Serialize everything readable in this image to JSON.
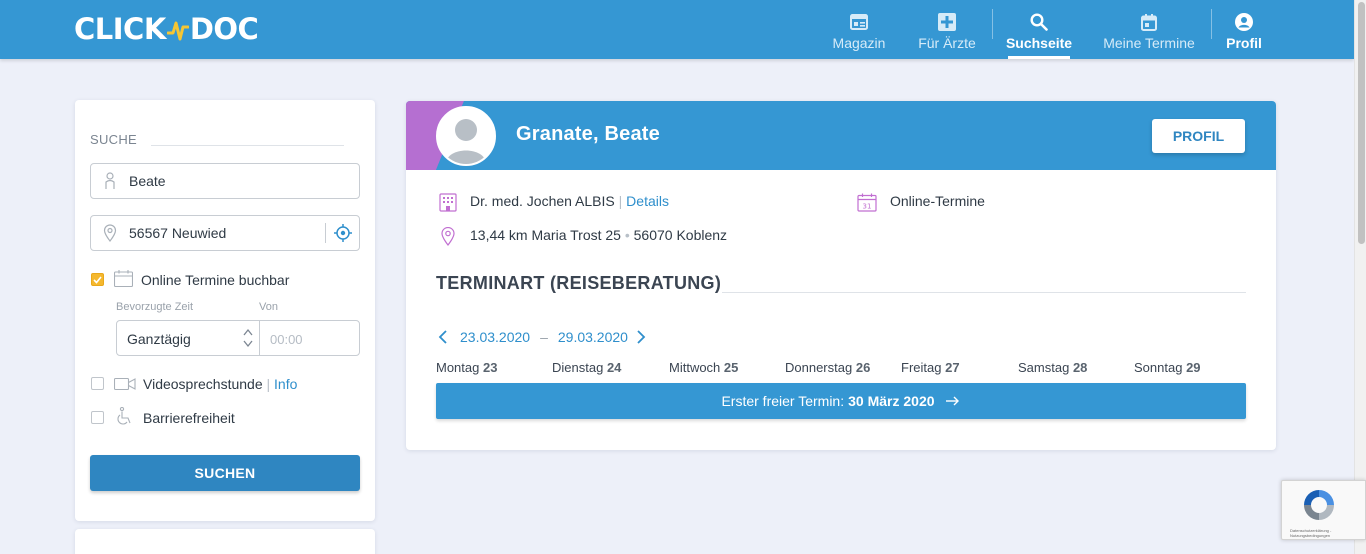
{
  "header": {
    "logo_left": "CLICK",
    "logo_right": "DOC",
    "nav": [
      {
        "label": "Magazin",
        "icon": "magazine-icon"
      },
      {
        "label": "Für Ärzte",
        "icon": "medical-cross-icon"
      },
      {
        "label": "Suchseite",
        "icon": "search-icon",
        "active": true
      },
      {
        "label": "Meine Termine",
        "icon": "calendar-icon"
      },
      {
        "label": "Profil",
        "icon": "user-circle-icon"
      }
    ]
  },
  "search": {
    "title": "SUCHE",
    "name_value": "Beate",
    "location_value": "56567 Neuwied",
    "online_label": "Online Termine buchbar",
    "online_checked": true,
    "pref_time_label": "Bevorzugte Zeit",
    "from_label": "Von",
    "time_select_value": "Ganztägig",
    "from_placeholder": "00:00",
    "video_label": "Videosprechstunde",
    "video_info": "Info",
    "barrier_label": "Barrierefreiheit",
    "submit_label": "SUCHEN"
  },
  "result": {
    "name": "Granate, Beate",
    "profile_button": "PROFIL",
    "practice": "Dr. med. Jochen ALBIS",
    "details_link": "Details",
    "online_appointments": "Online-Termine",
    "address": "13,44 km Maria Trost 25",
    "address_city": "56070 Koblenz",
    "terminart_title": "TERMINART (REISEBERATUNG)",
    "date_from": "23.03.2020",
    "date_to": "29.03.2020",
    "days": [
      {
        "name": "Montag",
        "num": "23"
      },
      {
        "name": "Dienstag",
        "num": "24"
      },
      {
        "name": "Mittwoch",
        "num": "25"
      },
      {
        "name": "Donnerstag",
        "num": "26"
      },
      {
        "name": "Freitag",
        "num": "27"
      },
      {
        "name": "Samstag",
        "num": "28"
      },
      {
        "name": "Sonntag",
        "num": "29"
      }
    ],
    "first_free_label": "Erster freier Termin:",
    "first_free_date": "30 März 2020"
  },
  "captcha": {
    "text": "Datenschutzerklärung - Nutzungsbedingungen"
  },
  "colors": {
    "brand_blue": "#3597d3",
    "button_blue": "#2f86c1",
    "accent_yellow": "#f5b82e",
    "accent_purple": "#b56fd1"
  }
}
